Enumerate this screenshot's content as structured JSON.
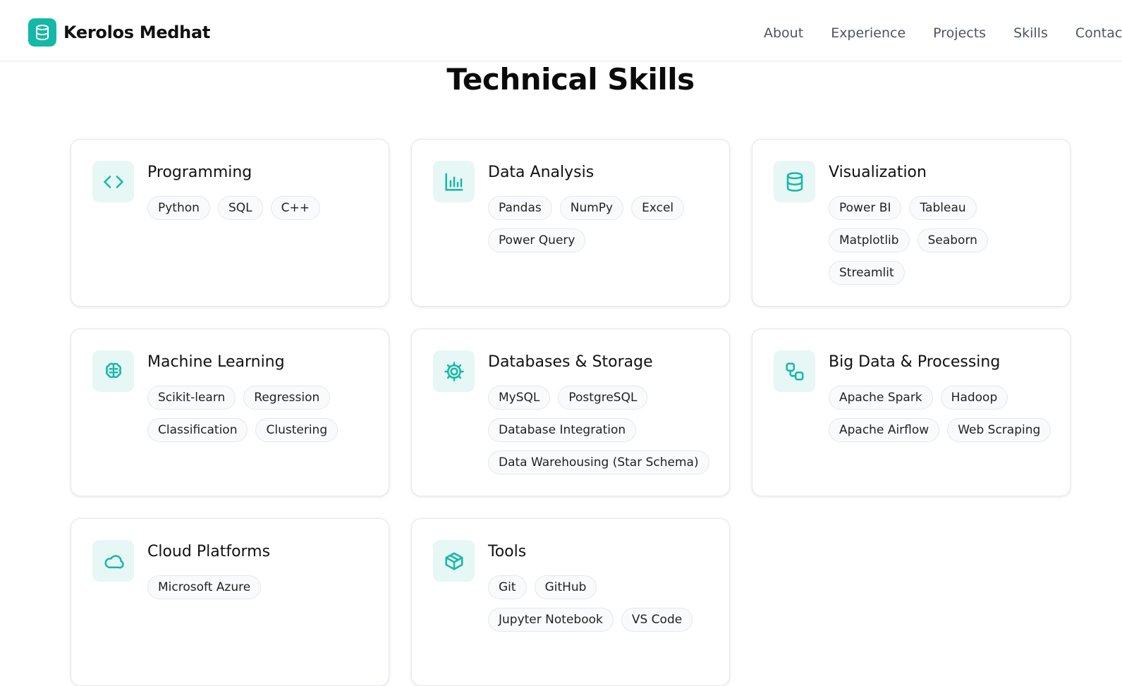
{
  "header": {
    "brand_name": "Kerolos Medhat",
    "nav": [
      {
        "label": "About"
      },
      {
        "label": "Experience"
      },
      {
        "label": "Projects"
      },
      {
        "label": "Skills"
      },
      {
        "label": "Contac"
      }
    ]
  },
  "section": {
    "title": "Technical Skills"
  },
  "colors": {
    "accent": "#14b8a6",
    "icon_bg": "#e6f7f5"
  },
  "cards": [
    {
      "title": "Programming",
      "icon": "code-icon",
      "tags": [
        "Python",
        "SQL",
        "C++"
      ]
    },
    {
      "title": "Data Analysis",
      "icon": "bar-chart-icon",
      "tags": [
        "Pandas",
        "NumPy",
        "Excel",
        "Power Query"
      ]
    },
    {
      "title": "Visualization",
      "icon": "database-icon",
      "tags": [
        "Power BI",
        "Tableau",
        "Matplotlib",
        "Seaborn",
        "Streamlit"
      ]
    },
    {
      "title": "Machine Learning",
      "icon": "brain-icon",
      "tags": [
        "Scikit-learn",
        "Regression",
        "Classification",
        "Clustering"
      ]
    },
    {
      "title": "Databases & Storage",
      "icon": "gear-icon",
      "tags": [
        "MySQL",
        "PostgreSQL",
        "Database Integration",
        "Data Warehousing (Star Schema)"
      ]
    },
    {
      "title": "Big Data & Processing",
      "icon": "workflow-icon",
      "tags": [
        "Apache Spark",
        "Hadoop",
        "Apache Airflow",
        "Web Scraping"
      ]
    },
    {
      "title": "Cloud Platforms",
      "icon": "cloud-icon",
      "tags": [
        "Microsoft Azure"
      ]
    },
    {
      "title": "Tools",
      "icon": "package-icon",
      "tags": [
        "Git",
        "GitHub",
        "Jupyter Notebook",
        "VS Code"
      ]
    }
  ]
}
